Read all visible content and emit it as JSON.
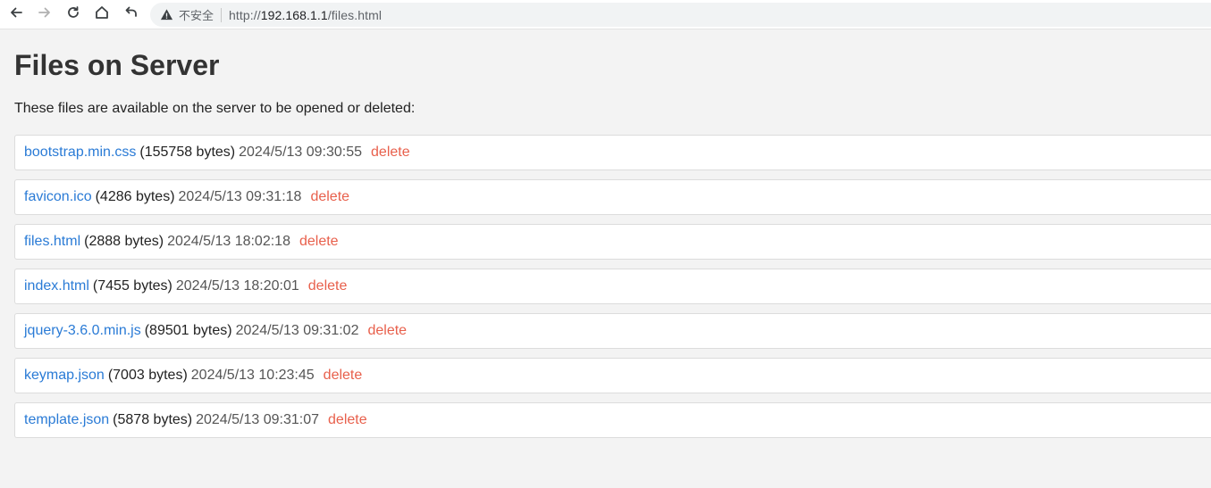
{
  "browser": {
    "security_label": "不安全",
    "url_scheme": "http://",
    "url_host": "192.168.1.1",
    "url_path": "/files.html",
    "icons": [
      "back-icon",
      "forward-icon",
      "reload-icon",
      "home-icon",
      "undo-icon",
      "warning-icon"
    ]
  },
  "page": {
    "title": "Files on Server",
    "description": "These files are available on the server to be opened or deleted:",
    "delete_label": "delete",
    "files": [
      {
        "name": "bootstrap.min.css",
        "size": "(155758 bytes)",
        "date": "2024/5/13 09:30:55"
      },
      {
        "name": "favicon.ico",
        "size": "(4286 bytes)",
        "date": "2024/5/13 09:31:18"
      },
      {
        "name": "files.html",
        "size": "(2888 bytes)",
        "date": "2024/5/13 18:02:18"
      },
      {
        "name": "index.html",
        "size": "(7455 bytes)",
        "date": "2024/5/13 18:20:01"
      },
      {
        "name": "jquery-3.6.0.min.js",
        "size": "(89501 bytes)",
        "date": "2024/5/13 09:31:02"
      },
      {
        "name": "keymap.json",
        "size": "(7003 bytes)",
        "date": "2024/5/13 10:23:45"
      },
      {
        "name": "template.json",
        "size": "(5878 bytes)",
        "date": "2024/5/13 09:31:07"
      }
    ]
  },
  "colors": {
    "link": "#2a7bd6",
    "delete": "#e8604c",
    "background": "#f3f3f3"
  }
}
